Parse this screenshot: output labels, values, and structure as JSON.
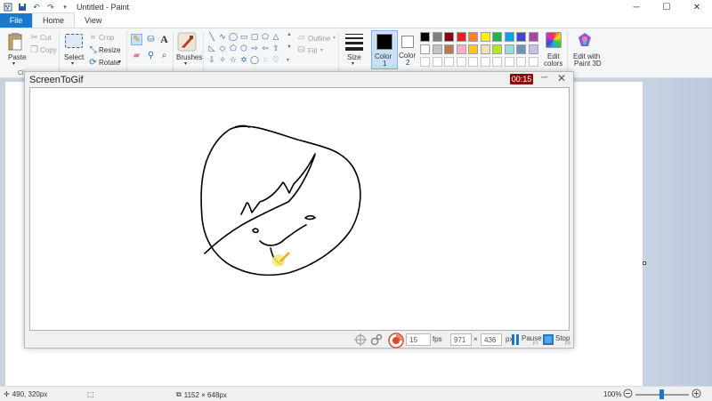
{
  "window": {
    "title": "Untitled - Paint",
    "controls": {
      "minimize": "─",
      "maximize": "☐",
      "close": "✕"
    }
  },
  "tabs": [
    {
      "label": "File"
    },
    {
      "label": "Home"
    },
    {
      "label": "View"
    }
  ],
  "ribbon": {
    "clipboard": {
      "paste": "Paste",
      "cut": "Cut",
      "copy": "Copy",
      "group_label": "Clip"
    },
    "image": {
      "select": "Select",
      "crop": "Crop",
      "resize": "Resize",
      "rotate": "Rotate"
    },
    "tools": {
      "brushes": "Brushes"
    },
    "shapes": {
      "outline": "Outline",
      "fill": "Fill"
    },
    "size": "Size",
    "color1": "Color\n1",
    "color1_label": "Color",
    "color1_num": "1",
    "color2_label": "Color",
    "color2_num": "2",
    "edit_colors": "Edit",
    "edit_colors_2": "colors",
    "edit_paint3d": "Edit with",
    "edit_paint3d_2": "Paint 3D",
    "palette_row1": [
      "#000000",
      "#7f7f7f",
      "#880015",
      "#ed1c24",
      "#ff7f27",
      "#fff200",
      "#22b14c",
      "#00a2e8",
      "#3f48cc",
      "#a349a4"
    ],
    "palette_row2": [
      "#ffffff",
      "#c3c3c3",
      "#b97a57",
      "#ffaec9",
      "#ffc90e",
      "#efe4b0",
      "#b5e61d",
      "#99d9ea",
      "#7092be",
      "#c8bfe7"
    ]
  },
  "screentogif": {
    "title": "ScreenToGif",
    "timer": "00:15",
    "fps_value": "15",
    "fps_label": "fps",
    "width": "971",
    "times": "×",
    "height": "436",
    "px_label": "px",
    "pause": "Pause",
    "pause_key": "F7",
    "stop": "Stop",
    "stop_key": "F8"
  },
  "status": {
    "cursor": "490, 320px",
    "dimensions": "1152 × 648px",
    "zoom": "100%",
    "zoom_level_percent": 100
  }
}
